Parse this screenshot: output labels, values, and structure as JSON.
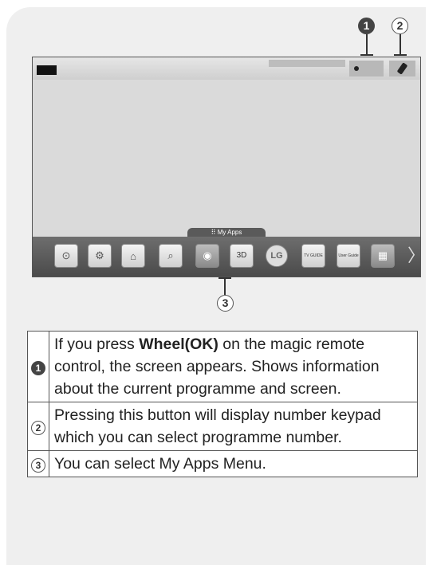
{
  "callouts": {
    "c1": "1",
    "c2": "2",
    "c3": "3"
  },
  "screen": {
    "icons": [
      {
        "name": "input-icon",
        "label": ""
      },
      {
        "name": "settings-icon",
        "label": ""
      },
      {
        "name": "home-icon",
        "label": ""
      },
      {
        "name": "search-icon",
        "label": ""
      },
      {
        "name": "internet-icon",
        "label": ""
      },
      {
        "name": "3d-icon",
        "label": "3D"
      },
      {
        "name": "lg-icon",
        "label": "LG"
      },
      {
        "name": "tv-guide-icon",
        "label": "TV GUIDE"
      },
      {
        "name": "user-guide-icon",
        "label": "User Guide"
      },
      {
        "name": "photo-icon",
        "label": ""
      }
    ],
    "my_apps_label": "My Apps"
  },
  "legend": {
    "row1": {
      "num": "1",
      "pre": "If you press ",
      "bold": "Wheel(OK)",
      "post": " on the magic remote control, the screen appears. Shows information about the current programme and screen."
    },
    "row2": {
      "num": "2",
      "text": "Pressing this button will display number keypad which you can select programme number."
    },
    "row3": {
      "num": "3",
      "text": "You can select My Apps Menu."
    }
  }
}
